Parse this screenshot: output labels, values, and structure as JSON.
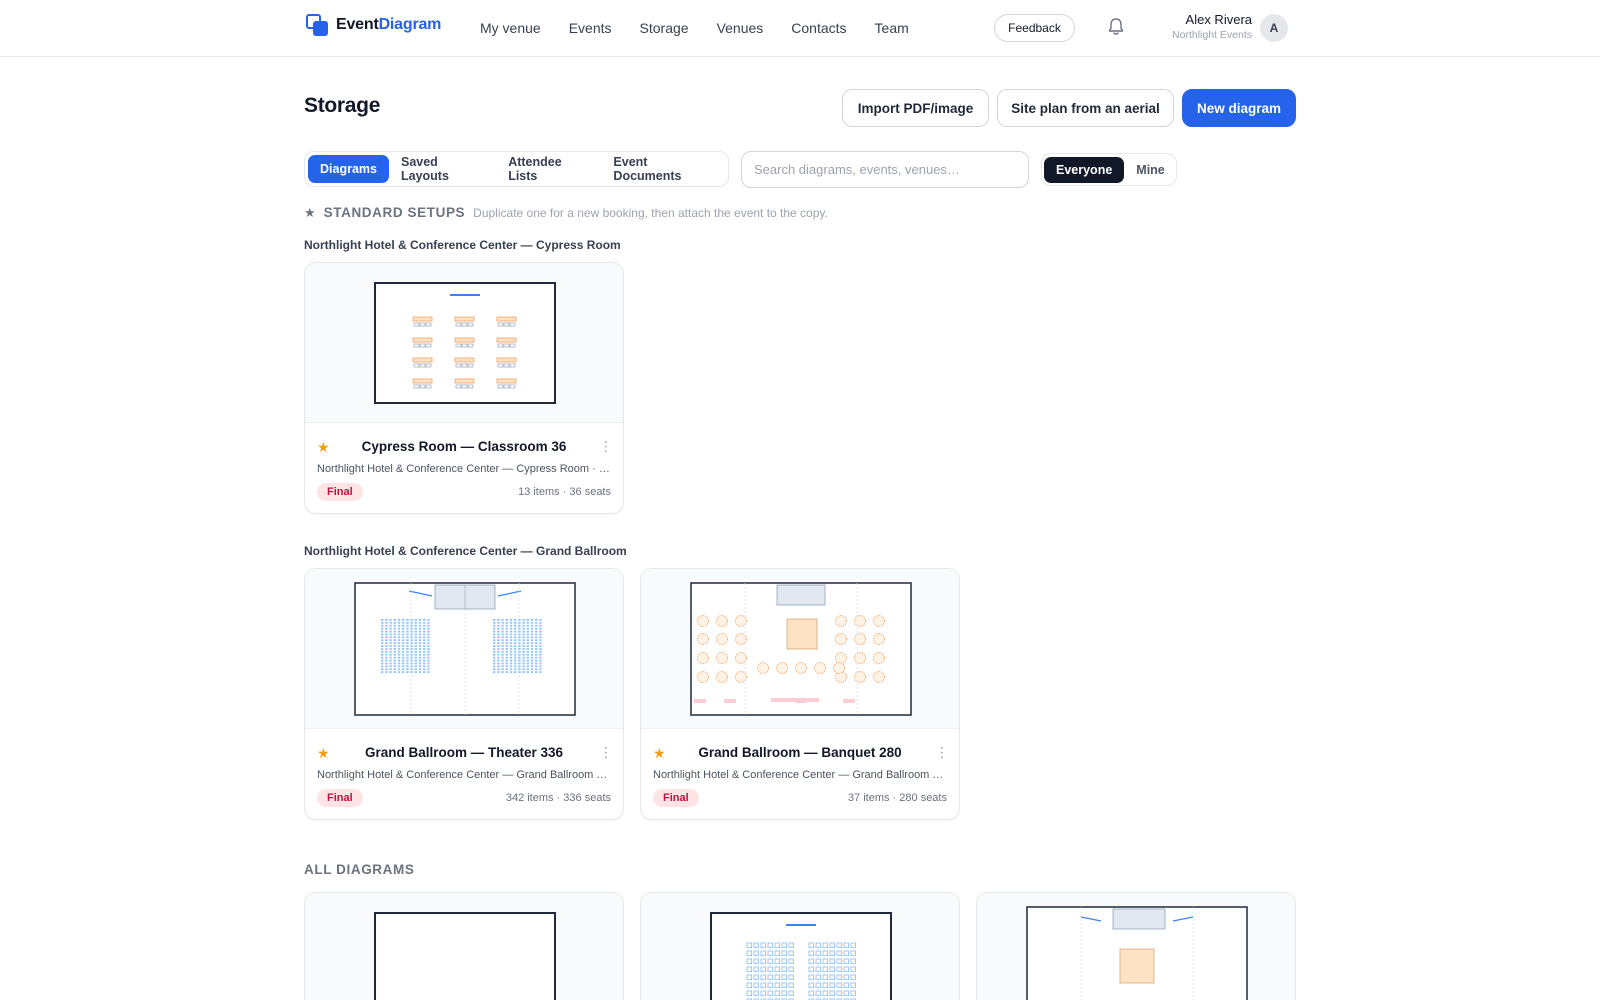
{
  "app": {
    "logo_part1": "Event",
    "logo_part2": "Diagram"
  },
  "nav": {
    "items": [
      {
        "label": "My venue"
      },
      {
        "label": "Events"
      },
      {
        "label": "Storage"
      },
      {
        "label": "Venues"
      },
      {
        "label": "Contacts"
      },
      {
        "label": "Team"
      }
    ],
    "feedback_label": "Feedback",
    "notification_icon": "bell-icon"
  },
  "user": {
    "name": "Alex Rivera",
    "org": "Northlight Events",
    "initial": "A"
  },
  "page": {
    "title": "Storage",
    "buttons": {
      "import": "Import PDF/image",
      "site_plan": "Site plan from an aerial",
      "new_diagram": "New diagram"
    }
  },
  "tabs": [
    {
      "label": "Diagrams",
      "active": true
    },
    {
      "label": "Saved Layouts",
      "active": false
    },
    {
      "label": "Attendee Lists",
      "active": false
    },
    {
      "label": "Event Documents",
      "active": false
    }
  ],
  "search": {
    "placeholder": "Search diagrams, events, venues…"
  },
  "scope": {
    "everyone": "Everyone",
    "mine": "Mine",
    "selected": "Everyone"
  },
  "standard_setups": {
    "star": "★",
    "title": "STANDARD SETUPS",
    "hint": "Duplicate one for a new booking, then attach the event to the copy.",
    "groups": [
      {
        "venue": "Northlight Hotel & Conference Center — Cypress Room",
        "cards": [
          {
            "title": "Cypress Room — Classroom 36",
            "subtitle": "Northlight Hotel & Conference Center — Cypress Room · …",
            "status": "Final",
            "meta": "13 items · 36 seats",
            "starred": "★",
            "menu": "⋮"
          }
        ]
      },
      {
        "venue": "Northlight Hotel & Conference Center — Grand Ballroom",
        "cards": [
          {
            "title": "Grand Ballroom — Theater 336",
            "subtitle": "Northlight Hotel & Conference Center — Grand Ballroom · …",
            "status": "Final",
            "meta": "342 items · 336 seats",
            "starred": "★",
            "menu": "⋮"
          },
          {
            "title": "Grand Ballroom — Banquet 280",
            "subtitle": "Northlight Hotel & Conference Center — Grand Ballroom · …",
            "status": "Final",
            "meta": "37 items · 280 seats",
            "starred": "★",
            "menu": "⋮"
          }
        ]
      }
    ]
  },
  "all_diagrams": {
    "title": "ALL DIAGRAMS"
  },
  "colors": {
    "accent": "#2563eb",
    "star": "#f59e0b",
    "final_badge": "#be123c"
  }
}
